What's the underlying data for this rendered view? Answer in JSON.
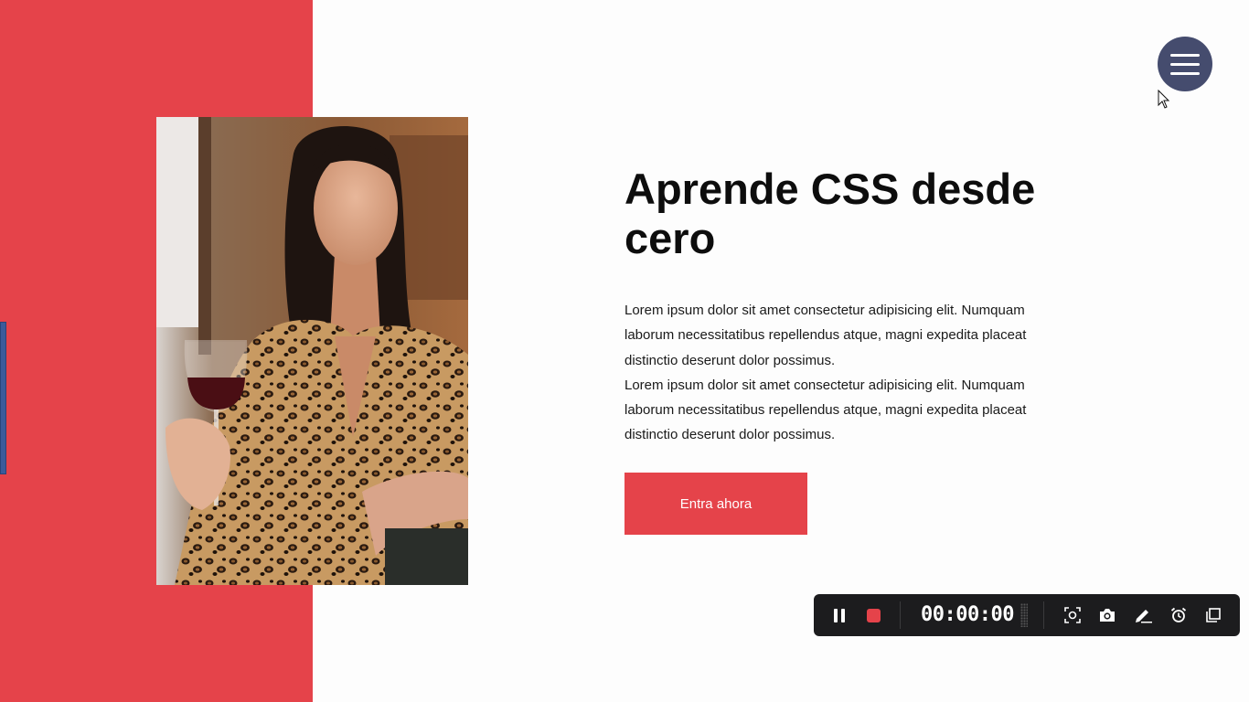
{
  "hero": {
    "title": "Aprende CSS desde cero",
    "paragraphs": [
      "Lorem ipsum dolor sit amet consectetur adipisicing elit. Numquam laborum necessitatibus repellendus atque, magni expedita placeat distinctio deserunt dolor possimus.",
      "Lorem ipsum dolor sit amet consectetur adipisicing elit. Numquam laborum necessitatibus repellendus atque, magni expedita placeat distinctio deserunt dolor possimus."
    ],
    "cta_label": "Entra ahora",
    "image": "woman-holding-wine-glass-photo"
  },
  "nav": {
    "menu_icon": "hamburger-menu-icon"
  },
  "recorder": {
    "time": "00:00:00",
    "icons": [
      "pause-icon",
      "stop-icon",
      "screenshot-region-icon",
      "camera-icon",
      "pen-icon",
      "alarm-icon",
      "window-icon"
    ]
  },
  "colors": {
    "accent_red": "#e5434a",
    "menu_button": "#454c6e",
    "page_background": "#fdfdfd",
    "recorder_background": "#1c1c1e",
    "side_tab": "#3b5b9a"
  }
}
